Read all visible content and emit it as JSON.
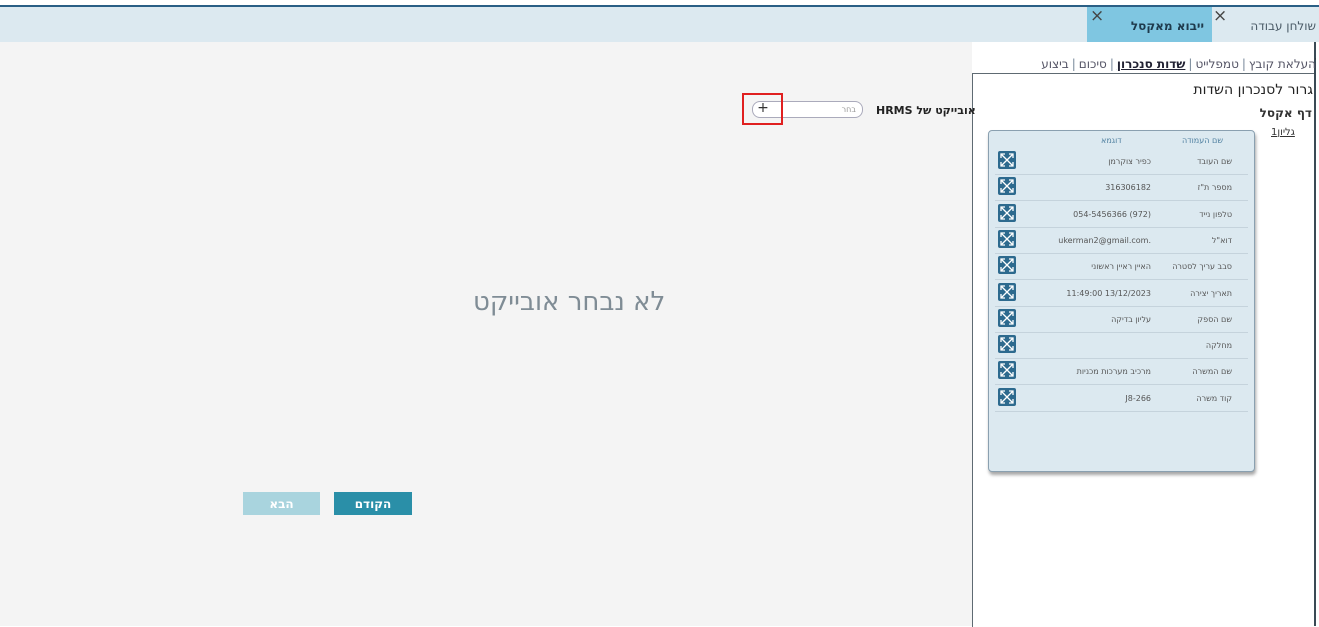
{
  "tabs": [
    {
      "label": "שולחן עבודה",
      "close_icon": "close-icon"
    },
    {
      "label": "ייבוא מאקסל",
      "close_icon": "close-icon",
      "active": true
    }
  ],
  "steps": [
    {
      "label": "העלאת קובץ"
    },
    {
      "label": "טמפלייט"
    },
    {
      "label": "שדות סנכרון",
      "active": true
    },
    {
      "label": "סיכום"
    },
    {
      "label": "ביצוע"
    }
  ],
  "panel": {
    "title": "גרור לסנכרון השדות",
    "subtitle": "דף אקסל",
    "sheet": "גליון1",
    "col_name": "שם העמודה",
    "col_example": "דוגמא",
    "fields": [
      {
        "name": "שם העובד",
        "example": "כפיר צוקרמן"
      },
      {
        "name": "מספר ת\"ז",
        "example": "316306182"
      },
      {
        "name": "טלפון נייד",
        "example": "054-5456366 (972)"
      },
      {
        "name": "דוא\"ל",
        "example": "ukerman2@gmail.com."
      },
      {
        "name": "סבב עריך לסטרה",
        "example": "האיין ראיין ראשוני"
      },
      {
        "name": "תאריך יצירה",
        "example": "11:49:00 13/12/2023"
      },
      {
        "name": "שם הספק",
        "example": "עליון בדיקה"
      },
      {
        "name": "מחלקה",
        "example": ""
      },
      {
        "name": "שם המשרה",
        "example": "מרכיב מערכות מכניות"
      },
      {
        "name": "קוד משרה",
        "example": "J8-266"
      }
    ]
  },
  "hrms": {
    "label": "אובייקט של HRMS",
    "select_placeholder": "בחר",
    "add_symbol": "+"
  },
  "main": {
    "empty_message": "לא נבחר אובייקט"
  },
  "buttons": {
    "prev": "הקודם",
    "next": "הבא"
  },
  "colors": {
    "accent": "#2a8fa8",
    "active_tab": "#7fc6e1",
    "drag_handle": "#2d6a8e",
    "highlight": "#e02020"
  }
}
